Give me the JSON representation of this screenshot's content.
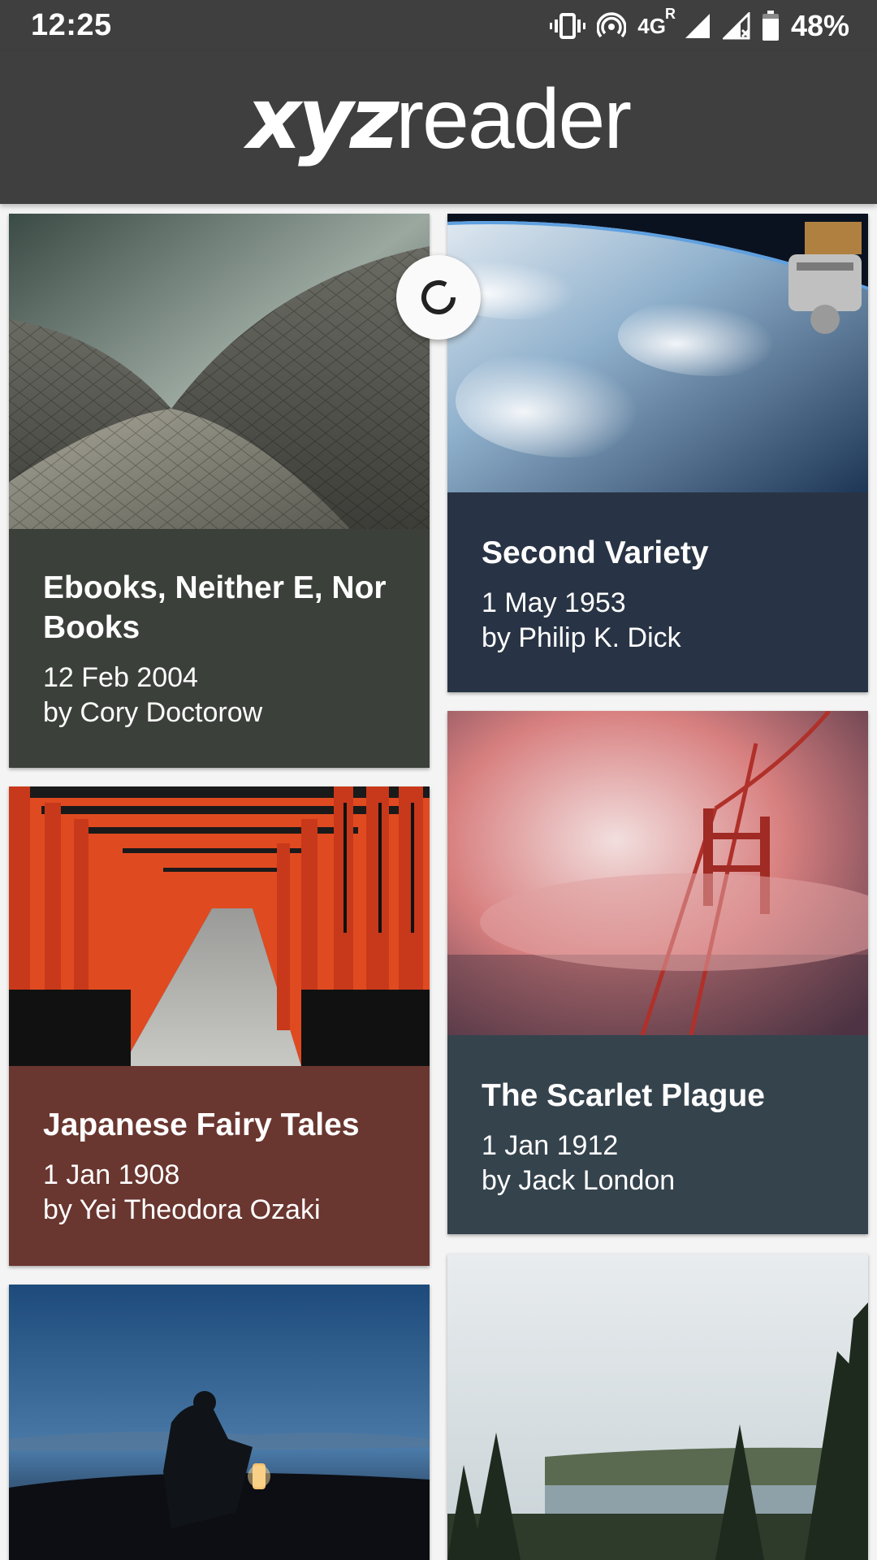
{
  "status_bar": {
    "time": "12:25",
    "network": "4G",
    "network_superscript": "R",
    "battery": "48%",
    "icons": [
      "vibrate-icon",
      "hotspot-icon",
      "signal-icon",
      "signal-no-data-icon",
      "battery-icon"
    ]
  },
  "app_bar": {
    "logo_part1": "xyz",
    "logo_part2": "reader"
  },
  "colors": {
    "bar": "#3f3f3f",
    "card1": "#3b403a",
    "card2": "#283445",
    "card3": "#6a3630",
    "card4": "#35434d"
  },
  "articles": [
    {
      "title": "Ebooks, Neither E, Nor Books",
      "date": "12 Feb 2004",
      "author": "by Cory Doctorow"
    },
    {
      "title": "Second Variety",
      "date": "1 May 1953",
      "author": "by Philip K. Dick"
    },
    {
      "title": "Japanese Fairy Tales",
      "date": "1 Jan 1908",
      "author": "by Yei Theodora Ozaki"
    },
    {
      "title": "The Scarlet Plague",
      "date": "1 Jan 1912",
      "author": "by Jack London"
    }
  ]
}
